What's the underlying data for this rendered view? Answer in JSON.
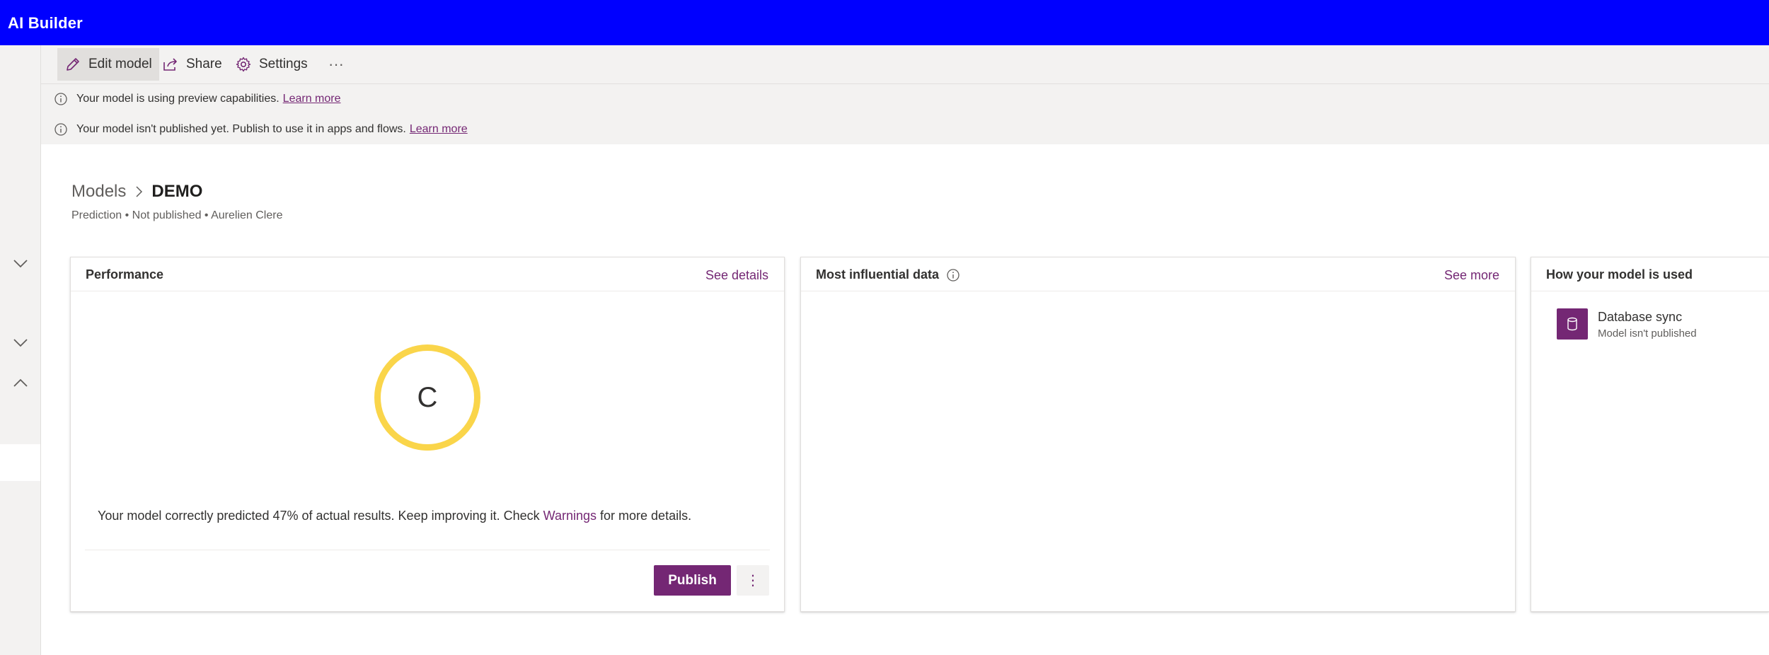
{
  "app": {
    "title": "AI Builder"
  },
  "commands": {
    "edit_model": "Edit model",
    "share": "Share",
    "settings": "Settings",
    "more": "···"
  },
  "messages": [
    {
      "text": "Your model is using preview capabilities.",
      "link": "Learn more"
    },
    {
      "text": "Your model isn't published yet. Publish to use it in apps and flows.",
      "link": "Learn more"
    }
  ],
  "breadcrumb": {
    "parent": "Models",
    "current": "DEMO"
  },
  "subtitle": "Prediction • Not published • Aurelien Clere",
  "performance": {
    "title": "Performance",
    "link": "See details",
    "grade": "C",
    "text_before": "Your model correctly predicted 47% of actual results. Keep improving it. Check",
    "warnings_link": "Warnings",
    "text_after": "for more details.",
    "publish_label": "Publish",
    "more_label": "⋮"
  },
  "influential": {
    "title": "Most influential data",
    "link": "See more"
  },
  "usage": {
    "title": "How your model is used",
    "items": [
      {
        "name": "Database sync",
        "status": "Model isn't published"
      }
    ]
  },
  "colors": {
    "topbar": "#0000ff",
    "accent": "#742774",
    "grade_ring": "#fad54a"
  }
}
